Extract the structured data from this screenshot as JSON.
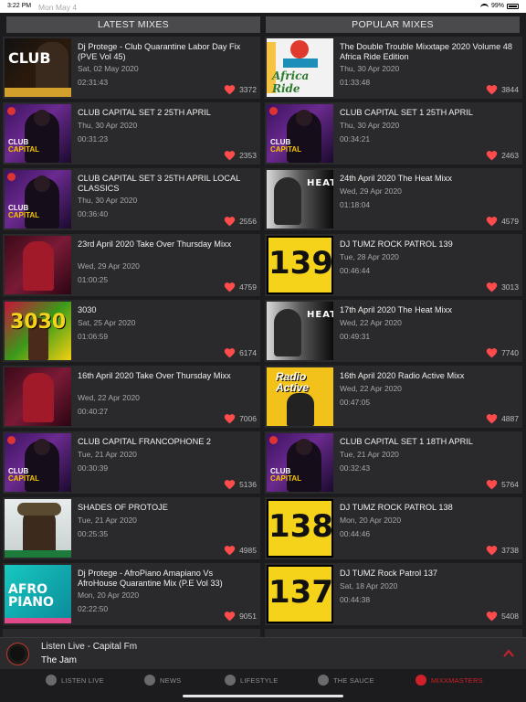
{
  "status_bar": {
    "time": "3:22 PM",
    "date": "Mon May 4",
    "battery": "99%"
  },
  "headers": {
    "latest": "LATEST MIXES",
    "popular": "POPULAR MIXES"
  },
  "latest": [
    {
      "title": "Dj Protege - Club Quarantine Labor Day Fix (PVE Vol 45)",
      "date": "Sat, 02 May 2020",
      "duration": "02:31:43",
      "likes": "3372",
      "thumb": "quar",
      "thumb_text": "CLUB"
    },
    {
      "title": "CLUB CAPITAL SET 2 25TH APRIL",
      "date": "Thu, 30 Apr 2020",
      "duration": "00:31:23",
      "likes": "2353",
      "thumb": "club"
    },
    {
      "title": "CLUB CAPITAL SET 3 25TH APRIL LOCAL CLASSICS",
      "date": "Thu, 30 Apr 2020",
      "duration": "00:36:40",
      "likes": "2556",
      "thumb": "club"
    },
    {
      "title": "23rd April 2020 Take Over Thursday Mixx",
      "date": "Wed, 29 Apr 2020",
      "duration": "01:00:25",
      "likes": "4759",
      "thumb": "hits"
    },
    {
      "title": "3030",
      "date": "Sat, 25 Apr 2020",
      "duration": "01:06:59",
      "likes": "6174",
      "thumb": "3030",
      "thumb_text": "3030"
    },
    {
      "title": "16th April 2020 Take Over Thursday Mixx",
      "date": "Wed, 22 Apr 2020",
      "duration": "00:40:27",
      "likes": "7006",
      "thumb": "hits"
    },
    {
      "title": "CLUB CAPITAL FRANCOPHONE 2",
      "date": "Tue, 21 Apr 2020",
      "duration": "00:30:39",
      "likes": "5136",
      "thumb": "club"
    },
    {
      "title": "SHADES OF PROTOJE",
      "date": "Tue, 21 Apr 2020",
      "duration": "00:25:35",
      "likes": "4985",
      "thumb": "shades"
    },
    {
      "title": "Dj Protege - AfroPiano Amapiano Vs AfroHouse Quarantine Mix (P.E Vol 33)",
      "date": "Mon, 20 Apr 2020",
      "duration": "02:22:50",
      "likes": "9051",
      "thumb": "afro",
      "thumb_text": "AFRO PIANO"
    }
  ],
  "popular": [
    {
      "title": "The Double Trouble Mixxtape 2020 Volume 48 Africa Ride Edition",
      "date": "Thu, 30 Apr 2020",
      "duration": "01:33:48",
      "likes": "3844",
      "thumb": "africa",
      "thumb_text": "Africa Ride"
    },
    {
      "title": "CLUB CAPITAL  SET 1 25TH APRIL",
      "date": "Thu, 30 Apr 2020",
      "duration": "00:34:21",
      "likes": "2463",
      "thumb": "club"
    },
    {
      "title": "24th April 2020 The Heat Mixx",
      "date": "Wed, 29 Apr 2020",
      "duration": "01:18:04",
      "likes": "4579",
      "thumb": "heat",
      "thumb_text": "HEAT"
    },
    {
      "title": "DJ TUMZ ROCK PATROL 139",
      "date": "Tue, 28 Apr 2020",
      "duration": "00:46:44",
      "likes": "3013",
      "thumb": "rock",
      "thumb_text": "139"
    },
    {
      "title": "17th April 2020 The Heat Mixx",
      "date": "Wed, 22 Apr 2020",
      "duration": "00:49:31",
      "likes": "7740",
      "thumb": "heat",
      "thumb_text": "HEAT"
    },
    {
      "title": "16th April 2020 Radio Active Mixx",
      "date": "Wed, 22 Apr 2020",
      "duration": "00:47:05",
      "likes": "4887",
      "thumb": "radio",
      "thumb_text": "Radio Active"
    },
    {
      "title": "CLUB CAPITAL  SET 1 18TH APRIL",
      "date": "Tue, 21 Apr 2020",
      "duration": "00:32:43",
      "likes": "5764",
      "thumb": "club"
    },
    {
      "title": "DJ TUMZ ROCK PATROL 138",
      "date": "Mon, 20 Apr 2020",
      "duration": "00:44:46",
      "likes": "3738",
      "thumb": "rock",
      "thumb_text": "138"
    },
    {
      "title": "DJ TUMZ Rock Patrol 137",
      "date": "Sat, 18 Apr 2020",
      "duration": "00:44:38",
      "likes": "5408",
      "thumb": "rock",
      "thumb_text": "137"
    }
  ],
  "player": {
    "station": "Listen Live - Capital Fm",
    "song": "The Jam"
  },
  "tabs": [
    {
      "label": "LISTEN LIVE",
      "icon": "play-circle-icon",
      "active": false
    },
    {
      "label": "NEWS",
      "icon": "newspaper-icon",
      "active": false
    },
    {
      "label": "LIFESTYLE",
      "icon": "home-icon",
      "active": false
    },
    {
      "label": "THE SAUCE",
      "icon": "sauce-bottle-icon",
      "active": false
    },
    {
      "label": "MIXXMASTERS",
      "icon": "headphones-icon",
      "active": true
    }
  ],
  "colors": {
    "accent": "#d0202a",
    "heart": "#ff4b4b",
    "card": "#2a2a2c",
    "background": "#1c1c1e"
  }
}
